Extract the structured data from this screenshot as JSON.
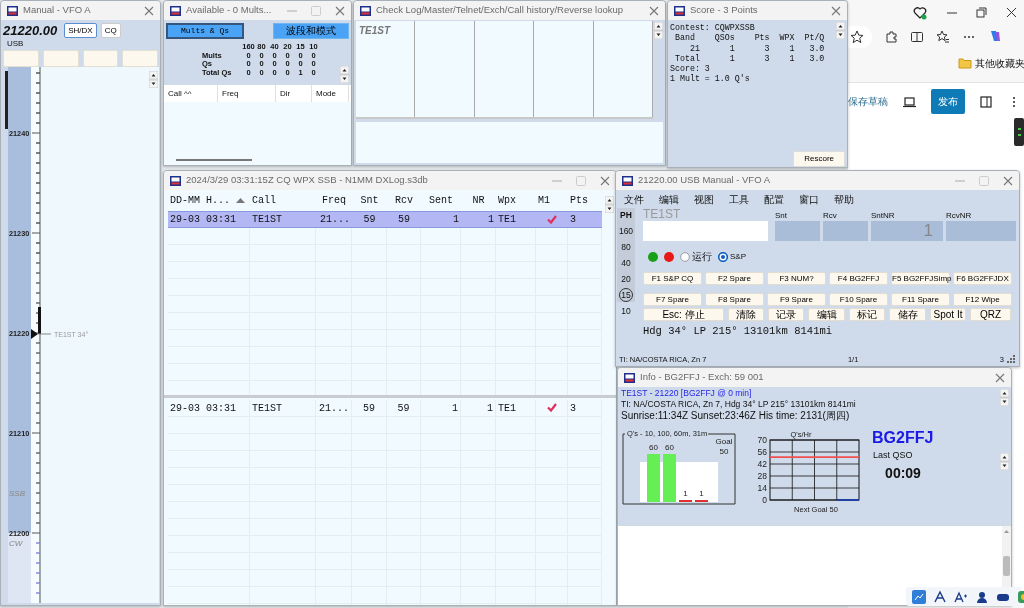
{
  "bandmap": {
    "title": "Manual - VFO A",
    "frequency": "21220.00",
    "buttons": [
      {
        "label": "SH/DX",
        "selected": true
      },
      {
        "label": "CQ",
        "selected": false
      }
    ],
    "mode": "USB",
    "scale_labels": [
      "21240",
      "21230",
      "21220",
      "21210",
      "21200"
    ],
    "segments": [
      "SSB",
      "CW"
    ],
    "spot": "TE1ST 34°"
  },
  "available": {
    "title": "Available - 0 Mults...",
    "buttons": [
      {
        "label": "Mults & Qs",
        "selected": true
      },
      {
        "label": "波段和模式",
        "selected": false
      }
    ],
    "bands": [
      "160",
      "80",
      "40",
      "20",
      "15",
      "10"
    ],
    "rows": [
      {
        "label": "Mults",
        "values": [
          "0",
          "0",
          "0",
          "0",
          "0",
          "0"
        ]
      },
      {
        "label": "Qs",
        "values": [
          "0",
          "0",
          "0",
          "0",
          "0",
          "0"
        ]
      },
      {
        "label": "Total Qs",
        "values": [
          "0",
          "0",
          "0",
          "0",
          "1",
          "0"
        ]
      }
    ],
    "columns": [
      "Call ^^",
      "Freq",
      "Dir",
      "Mode"
    ]
  },
  "check_log": {
    "title": "Check Log/Master/Telnet/Exch/Call history/Reverse lookup",
    "call": "TE1ST"
  },
  "score": {
    "title": "Score - 3 Points",
    "lines": [
      "Contest: CQWPXSSB",
      " Band    QSOs    Pts  WPX  Pt/Q",
      "    21      1      3    1   3.0",
      " Total      1      3    1   3.0",
      "Score: 3",
      "1 Mult = 1.0 Q's"
    ],
    "button": "Rescore"
  },
  "browser": {
    "bookmark_folder": "其他收藏夹",
    "save_draft": "保存草稿",
    "publish": "发布"
  },
  "log": {
    "title": "2024/3/29 03:31:15Z  CQ WPX SSB - N1MM DXLog.s3db",
    "columns": [
      "DD-MM H...",
      "Call",
      "Freq",
      "Snt",
      "Rcv",
      "Sent",
      "NR",
      "Wpx",
      "M1",
      "Pts"
    ],
    "rows": [
      {
        "cells": [
          "29-03 03:31",
          "TE1ST",
          "21...",
          "59",
          "59",
          "1",
          "1",
          "TE1"
        ],
        "m1": true,
        "pts": "3",
        "selected": true
      }
    ],
    "lower_rows": [
      {
        "cells": [
          "29-03 03:31",
          "TE1ST",
          "21...",
          "59",
          "59",
          "1",
          "1",
          "TE1"
        ],
        "m1": true,
        "pts": "3",
        "selected": false
      }
    ]
  },
  "entry": {
    "title": "21220.00 USB Manual - VFO A",
    "menu": [
      "文件",
      "编辑",
      "视图",
      "工具",
      "配置",
      "窗口",
      "帮助"
    ],
    "mode_label": "PH",
    "bands": [
      {
        "label": "160",
        "selected": false
      },
      {
        "label": "80",
        "selected": false
      },
      {
        "label": "40",
        "selected": false
      },
      {
        "label": "20",
        "selected": false
      },
      {
        "label": "15",
        "selected": true
      },
      {
        "label": "10",
        "selected": false
      }
    ],
    "last_call": "TE1ST",
    "fields": [
      {
        "label": "Snt"
      },
      {
        "label": "Rcv"
      },
      {
        "label": "SntNR",
        "value": "1"
      },
      {
        "label": "RcvNR"
      }
    ],
    "lights": [
      {
        "color": "#18a018"
      },
      {
        "color": "#e81818"
      }
    ],
    "modes": [
      {
        "label": "运行",
        "selected": false
      },
      {
        "label": "S&P",
        "selected": true
      }
    ],
    "keys": [
      [
        "F1 S&P CQ",
        "F2 Spare",
        "F3 NUM?",
        "F4 BG2FFJ",
        "F5 BG2FFJSimp",
        "F6 BG2FFJDX"
      ],
      [
        "F7 Spare",
        "F8 Spare",
        "F9 Spare",
        "F10 Spare",
        "F11 Spare",
        "F12 Wipe"
      ],
      [
        "Esc: 停止",
        "清除",
        "记录",
        "编辑",
        "标记",
        "储存",
        "Spot It",
        "QRZ"
      ]
    ],
    "bearing": "Hdg 34° LP 215° 13101km 8141mi",
    "status": [
      "TI: NA/COSTA RICA, Zn 7",
      "1/1",
      "3"
    ]
  },
  "info": {
    "title": "Info - BG2FFJ - Exch: 59 001",
    "lines": [
      {
        "text": "TE1ST - 21220 [BG2FFJ @ 0 min]",
        "kind": "link"
      },
      {
        "text": "TI: NA/COSTA RICA, Zn 7, Hdg 34° LP 215° 13101km 8141mi",
        "kind": "plain"
      },
      {
        "text": "Sunrise:11:34Z Sunset:23:46Z His time: 2131(周四)",
        "kind": "plain"
      }
    ],
    "qs_chart": {
      "title": "Q's - 10, 100, 60m, 31m",
      "bar_labels": [
        "60",
        "60",
        "1",
        "1"
      ],
      "goal_label": "Goal",
      "goal_value": "50"
    },
    "rate_chart": {
      "chart_data": {
        "type": "line",
        "title": "Q's/Hr",
        "xlabel": "Next Goal 50",
        "ylim": [
          0,
          70
        ],
        "grid": true,
        "yticks": [
          0,
          14,
          28,
          42,
          56,
          70
        ],
        "series": [
          {
            "color": "#f05050",
            "values": [
              50,
              50,
              50,
              50,
              50
            ]
          },
          {
            "color": "#2040a0",
            "values": [
              null,
              null,
              null,
              0,
              0
            ]
          }
        ]
      }
    },
    "callsign": "BG2FFJ",
    "last_qso_label": "Last QSO",
    "last_qso": "00:09"
  }
}
